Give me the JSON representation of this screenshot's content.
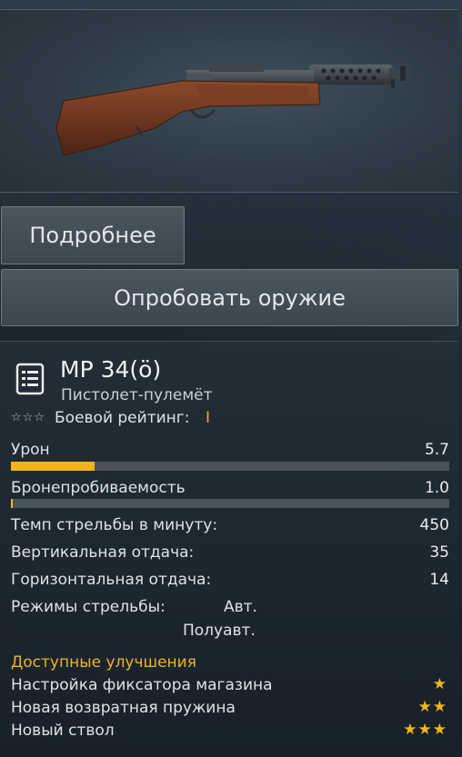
{
  "buttons": {
    "details": "Подробнее",
    "try_weapon": "Опробовать оружие"
  },
  "weapon": {
    "icon": "weapon-list-icon",
    "name": "MP 34(ö)",
    "class": "Пистолет-пулемёт",
    "rating_stars": "☆☆☆",
    "rating_label": "Боевой рейтинг:",
    "rating_value": "I"
  },
  "stats": {
    "damage": {
      "label": "Урон",
      "value": "5.7",
      "fill_fraction": 0.19
    },
    "penetration": {
      "label": "Бронепробиваемость",
      "value": "1.0",
      "fill_fraction": 0.004
    },
    "rate_of_fire": {
      "label": "Темп стрельбы в минуту:",
      "value": "450"
    },
    "vertical_recoil": {
      "label": "Вертикальная отдача:",
      "value": "35"
    },
    "horizontal_recoil": {
      "label": "Горизонтальная отдача:",
      "value": "14"
    },
    "fire_modes": {
      "label": "Режимы стрельбы:",
      "modes": [
        "Авт.",
        "Полуавт."
      ]
    }
  },
  "upgrades": {
    "title": "Доступные улучшения",
    "items": [
      {
        "label": "Настройка фиксатора магазина",
        "stars": "★"
      },
      {
        "label": "Новая возвратная пружина",
        "stars": "★★"
      },
      {
        "label": "Новый ствол",
        "stars": "★★★"
      }
    ]
  },
  "colors": {
    "accent": "#f2b519",
    "bar_bg": "#4a535b"
  }
}
